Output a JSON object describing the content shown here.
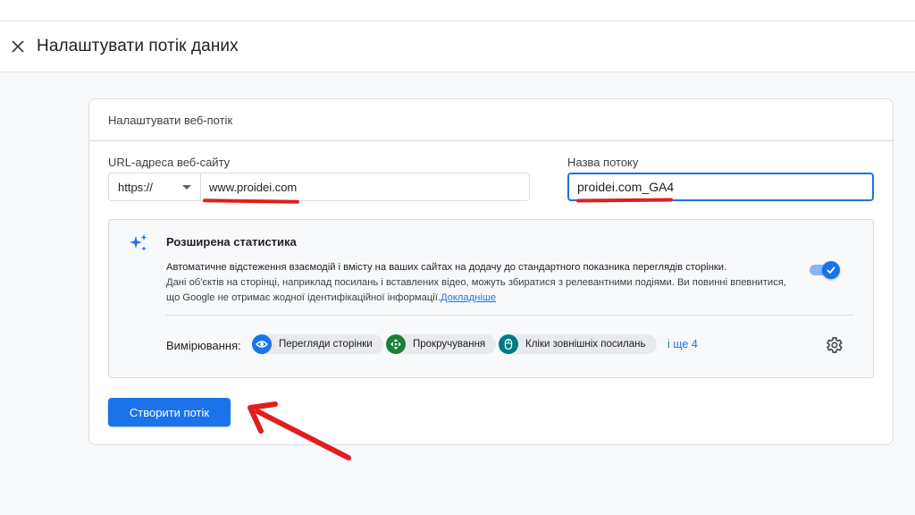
{
  "header": {
    "title": "Налаштувати потік даних"
  },
  "card": {
    "heading": "Налаштувати веб-потік",
    "url_field": {
      "label": "URL-адреса веб-сайту",
      "protocol": "https://",
      "value": "www.proidei.com"
    },
    "name_field": {
      "label": "Назва потоку",
      "value": "proidei.com_GA4"
    },
    "enhanced": {
      "title": "Розширена статистика",
      "description_line1": "Автоматичне відстеження взаємодій і вмісту на ваших сайтах на додачу до стандартного показника переглядів сторінки.",
      "description_line2": "Дані об'єктів на сторінці, наприклад посилань і вставлених відео, можуть збиратися з релевантними подіями. Ви повинні впевнитися,",
      "description_line3": "що Google не отримає жодної ідентифікаційної інформації.",
      "learn_more": "Докладніше",
      "toggle_on": true,
      "measuring_label": "Вимірювання:",
      "chips": [
        {
          "label": "Перегляди сторінки",
          "icon": "eye-icon",
          "color": "#1a73e8"
        },
        {
          "label": "Прокручування",
          "icon": "scroll-arrows-icon",
          "color": "#188038"
        },
        {
          "label": "Кліки зовнішніх посилань",
          "icon": "mouse-icon",
          "color": "#007b83"
        }
      ],
      "more": "і ще 4"
    },
    "create_button": "Створити потік"
  },
  "colors": {
    "accent": "#1a73e8",
    "annotation": "#e01e1e"
  }
}
